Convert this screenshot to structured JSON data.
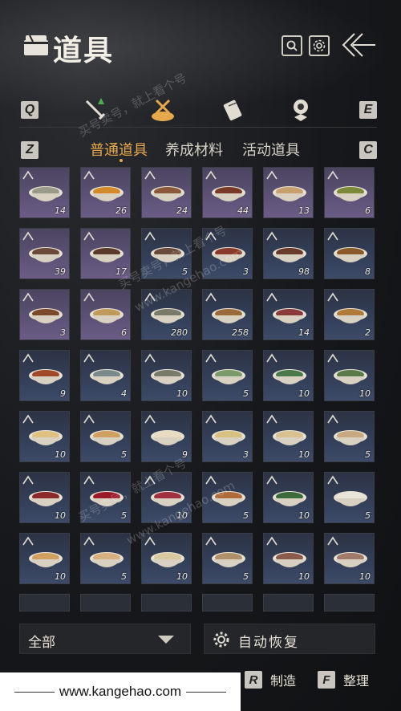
{
  "header": {
    "title": "道具",
    "title_icon": "chest-icon",
    "search_icon": "search-icon",
    "settings_icon": "gear-icon",
    "back_icon": "back-arrow-icon"
  },
  "category_keys": {
    "left": "Q",
    "right": "E"
  },
  "categories": [
    {
      "icon": "sword-icon"
    },
    {
      "icon": "food-dish-icon",
      "active": true
    },
    {
      "icon": "scroll-icon"
    },
    {
      "icon": "medal-icon"
    }
  ],
  "subtab_keys": {
    "left": "Z",
    "right": "C"
  },
  "subtabs": [
    "普通道具",
    "养成材料",
    "活动道具"
  ],
  "active_subtab": 0,
  "items": [
    {
      "count": "14",
      "rarity": "purple",
      "color": "#9a9a8a"
    },
    {
      "count": "26",
      "rarity": "purple",
      "color": "#d28a2a"
    },
    {
      "count": "24",
      "rarity": "purple",
      "color": "#8a5a3a"
    },
    {
      "count": "44",
      "rarity": "purple",
      "color": "#7a3a2a"
    },
    {
      "count": "13",
      "rarity": "purple",
      "color": "#c8a070"
    },
    {
      "count": "6",
      "rarity": "purple",
      "color": "#7a8a3a"
    },
    {
      "count": "39",
      "rarity": "purple",
      "color": "#6a4a3a"
    },
    {
      "count": "17",
      "rarity": "purple",
      "color": "#5a3a2a"
    },
    {
      "count": "5",
      "rarity": "blue",
      "color": "#6a4a3a"
    },
    {
      "count": "3",
      "rarity": "blue",
      "color": "#8a3a2a"
    },
    {
      "count": "98",
      "rarity": "blue",
      "color": "#6a3a2a"
    },
    {
      "count": "8",
      "rarity": "blue",
      "color": "#8a5a2a"
    },
    {
      "count": "3",
      "rarity": "purple",
      "color": "#7a4a2a"
    },
    {
      "count": "6",
      "rarity": "purple",
      "color": "#c09a5a"
    },
    {
      "count": "280",
      "rarity": "blue",
      "color": "#7a7a6a"
    },
    {
      "count": "258",
      "rarity": "blue",
      "color": "#9a6a3a"
    },
    {
      "count": "14",
      "rarity": "blue",
      "color": "#8a3a3a"
    },
    {
      "count": "2",
      "rarity": "blue",
      "color": "#b07a3a"
    },
    {
      "count": "9",
      "rarity": "blue",
      "color": "#a04a2a"
    },
    {
      "count": "4",
      "rarity": "blue",
      "color": "#7a8a8a"
    },
    {
      "count": "10",
      "rarity": "blue",
      "color": "#7a7a6a"
    },
    {
      "count": "5",
      "rarity": "blue",
      "color": "#7a9a6a"
    },
    {
      "count": "10",
      "rarity": "blue",
      "color": "#4a7a4a"
    },
    {
      "count": "10",
      "rarity": "blue",
      "color": "#5a7a4a"
    },
    {
      "count": "10",
      "rarity": "blue",
      "color": "#e0c080"
    },
    {
      "count": "5",
      "rarity": "blue",
      "color": "#d0a060"
    },
    {
      "count": "9",
      "rarity": "blue",
      "color": "#e8dcc0"
    },
    {
      "count": "3",
      "rarity": "blue",
      "color": "#d8c080"
    },
    {
      "count": "10",
      "rarity": "blue",
      "color": "#d8c090"
    },
    {
      "count": "5",
      "rarity": "blue",
      "color": "#c8a880"
    },
    {
      "count": "10",
      "rarity": "blue",
      "color": "#8a2a2a"
    },
    {
      "count": "5",
      "rarity": "blue",
      "color": "#9a1a2a"
    },
    {
      "count": "10",
      "rarity": "blue",
      "color": "#a03040"
    },
    {
      "count": "5",
      "rarity": "blue",
      "color": "#b06a3a"
    },
    {
      "count": "10",
      "rarity": "blue",
      "color": "#3a6a3a"
    },
    {
      "count": "5",
      "rarity": "blue",
      "color": "#e8e4d8"
    },
    {
      "count": "10",
      "rarity": "blue",
      "color": "#d0a060"
    },
    {
      "count": "5",
      "rarity": "blue",
      "color": "#d8b080"
    },
    {
      "count": "10",
      "rarity": "blue",
      "color": "#d8c8a0"
    },
    {
      "count": "5",
      "rarity": "blue",
      "color": "#b0906a"
    },
    {
      "count": "10",
      "rarity": "blue",
      "color": "#8a5a4a"
    },
    {
      "count": "10",
      "rarity": "blue",
      "color": "#a07a6a"
    }
  ],
  "partial_row_count": 6,
  "filter": {
    "label": "全部",
    "icon": "chevron-down-icon"
  },
  "auto_restore": {
    "label": "自动恢复",
    "icon": "gear-icon"
  },
  "hotkeys": [
    {
      "key": "R",
      "label": "制造"
    },
    {
      "key": "F",
      "label": "整理"
    }
  ],
  "url_bar": "www.kangehao.com",
  "watermarks": [
    "买号卖号，就上看个号",
    "www.kangehao.com"
  ]
}
